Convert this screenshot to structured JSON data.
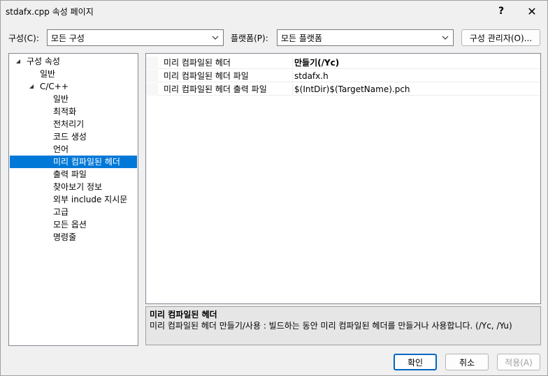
{
  "window": {
    "title": "stdafx.cpp 속성 페이지",
    "help_glyph": "?",
    "close_glyph": "✕"
  },
  "toolbar": {
    "config_label": "구성(C):",
    "config_value": "모든 구성",
    "platform_label": "플랫폼(P):",
    "platform_value": "모든 플랫폼",
    "config_manager_button": "구성 관리자(O)..."
  },
  "tree": {
    "items": [
      {
        "label": "구성 속성",
        "level": 0,
        "expanded": true
      },
      {
        "label": "일반",
        "level": 1
      },
      {
        "label": "C/C++",
        "level": 1,
        "expanded": true
      },
      {
        "label": "일반",
        "level": 2
      },
      {
        "label": "최적화",
        "level": 2
      },
      {
        "label": "전처리기",
        "level": 2
      },
      {
        "label": "코드 생성",
        "level": 2
      },
      {
        "label": "언어",
        "level": 2
      },
      {
        "label": "미리 컴파일된 헤더",
        "level": 2,
        "selected": true
      },
      {
        "label": "출력 파일",
        "level": 2
      },
      {
        "label": "찾아보기 정보",
        "level": 2
      },
      {
        "label": "외부 include 지시문",
        "level": 2
      },
      {
        "label": "고급",
        "level": 2
      },
      {
        "label": "모든 옵션",
        "level": 2
      },
      {
        "label": "명령줄",
        "level": 2
      }
    ]
  },
  "grid": {
    "rows": [
      {
        "name": "미리 컴파일된 헤더",
        "value": "만들기(/Yc)",
        "bold": true
      },
      {
        "name": "미리 컴파일된 헤더 파일",
        "value": "stdafx.h",
        "bold": false
      },
      {
        "name": "미리 컴파일된 헤더 출력 파일",
        "value": "$(IntDir)$(TargetName).pch",
        "bold": false
      }
    ]
  },
  "description": {
    "title": "미리 컴파일된 헤더",
    "text": "미리 컴파일된 헤더 만들기/사용 : 빌드하는 동안 미리 컴파일된 헤더를 만들거나 사용합니다.     (/Yc, /Yu)"
  },
  "buttons": {
    "ok": "확인",
    "cancel": "취소",
    "apply": "적용(A)"
  },
  "colors": {
    "selection": "#0078d7",
    "primary_border": "#0067c0"
  }
}
